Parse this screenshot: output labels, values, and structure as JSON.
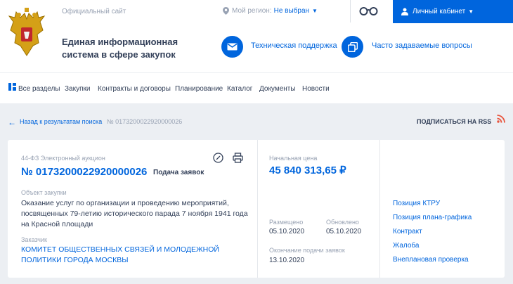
{
  "header": {
    "official_site": "Официальный сайт",
    "system_title": "Единая информационная система в сфере закупок",
    "region_label": "Мой регион:",
    "region_value": "Не выбран",
    "cabinet_label": "Личный кабинет",
    "support_label": "Техническая поддержка",
    "faq_label": "Часто задаваемые вопросы"
  },
  "nav": {
    "items": [
      {
        "label": "Все разделы"
      },
      {
        "label": "Закупки"
      },
      {
        "label": "Контракты и договоры"
      },
      {
        "label": "Планирование"
      },
      {
        "label": "Каталог"
      },
      {
        "label": "Документы"
      },
      {
        "label": "Новости"
      }
    ],
    "active": "Закупки"
  },
  "breadcrumb": {
    "back_label": "Назад к результатам поиска",
    "separator": "•",
    "current": "№ 0173200022920000026"
  },
  "rss_label": "ПОДПИСАТЬСЯ НА RSS",
  "purchase": {
    "procedure_type": "44-ФЗ Электронный аукцион",
    "number": "№ 0173200022920000026",
    "status": "Подача заявок",
    "object_label": "Объект закупки",
    "object_text": "Оказание услуг по организации и проведению мероприятий, посвященных 79-летию исторического парада 7 ноября 1941 года на Красной площади",
    "customer_label": "Заказчик",
    "customer_name": "КОМИТЕТ ОБЩЕСТВЕННЫХ СВЯЗЕЙ И МОЛОДЕЖНОЙ ПОЛИТИКИ ГОРОДА МОСКВЫ"
  },
  "pricing": {
    "initial_price_label": "Начальная цена",
    "initial_price": "45 840 313,65 ₽",
    "posted_label": "Размещено",
    "posted_date": "05.10.2020",
    "updated_label": "Обновлено",
    "updated_date": "05.10.2020",
    "deadline_label": "Окончание подачи заявок",
    "deadline_date": "13.10.2020"
  },
  "side_links": [
    {
      "label": "Позиция КТРУ"
    },
    {
      "label": "Позиция плана-графика"
    },
    {
      "label": "Контракт"
    },
    {
      "label": "Жалоба"
    },
    {
      "label": "Внеплановая проверка"
    }
  ],
  "colors": {
    "accent": "#0065dd",
    "text": "#334059",
    "muted": "#98a2b3",
    "background": "#eceff3",
    "rss": "#e8553e"
  }
}
